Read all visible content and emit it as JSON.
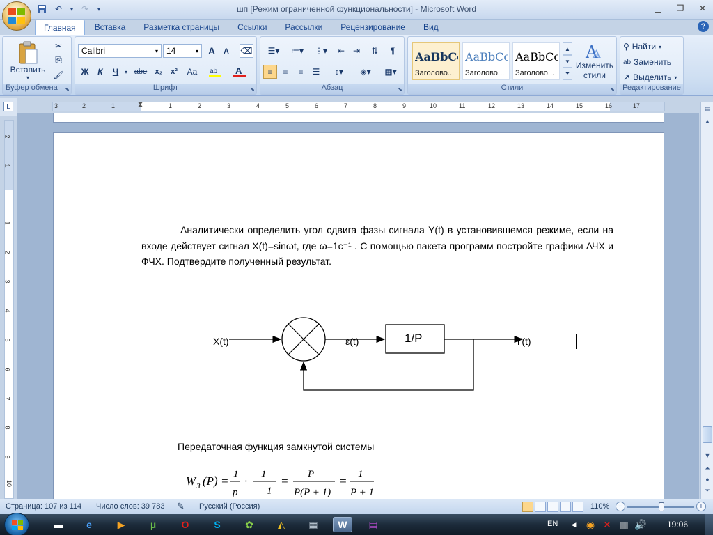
{
  "window": {
    "title": "шп [Режим ограниченной функциональности] - Microsoft Word"
  },
  "ribbon_tabs": [
    "Главная",
    "Вставка",
    "Разметка страницы",
    "Ссылки",
    "Рассылки",
    "Рецензирование",
    "Вид"
  ],
  "active_tab": "Главная",
  "clipboard": {
    "paste_label": "Вставить",
    "group_label": "Буфер обмена"
  },
  "font": {
    "name": "Calibri",
    "size": "14",
    "grow": "A",
    "shrink": "A",
    "bold": "Ж",
    "italic": "К",
    "underline": "Ч",
    "strike": "abe",
    "subscript": "x₂",
    "superscript": "x²",
    "change_case": "Aa",
    "group_label": "Шрифт"
  },
  "paragraph": {
    "group_label": "Абзац"
  },
  "styles": {
    "items": [
      {
        "sample": "AaBbCc",
        "name": "Заголово..."
      },
      {
        "sample": "AaBbCc",
        "name": "Заголово..."
      },
      {
        "sample": "AaBbCcI",
        "name": "Заголово..."
      }
    ],
    "change_line1": "Изменить",
    "change_line2": "стили",
    "group_label": "Стили"
  },
  "editing": {
    "find": "Найти",
    "replace": "Заменить",
    "select": "Выделить",
    "group_label": "Редактирование"
  },
  "ruler": {
    "h_numbers": [
      "3",
      "2",
      "1",
      "1",
      "2",
      "3",
      "4",
      "5",
      "6",
      "7",
      "8",
      "9",
      "10",
      "11",
      "12",
      "13",
      "14",
      "15",
      "16",
      "17"
    ],
    "v_numbers": [
      "2",
      "1",
      "1",
      "2",
      "3",
      "4",
      "5",
      "6",
      "7",
      "8",
      "9",
      "10"
    ]
  },
  "document": {
    "paragraph": "Аналитически определить угол сдвига фазы сигнала Y(t) в установившемся режиме, если на входе действует сигнал X(t)=sinωt, где ω=1c⁻¹ . С помощью пакета программ постройте графики АЧХ и ФЧХ. Подтвердите полученный результат.",
    "diagram": {
      "input": "X(t)",
      "error": "ε(t)",
      "block": "1/P",
      "output": "Y(t)"
    },
    "caption": "Передаточная функция замкнутой системы",
    "formula": {
      "lhs": "W",
      "lhs_sub": "З",
      "lhs_arg": "(P) =",
      "frac1_num": "1",
      "frac1_den": "p",
      "dot": "·",
      "frac2_num": "1",
      "frac2_den": "1",
      "eq1": "=",
      "frac3_num": "P",
      "frac3_den": "P(P + 1)",
      "eq2": "=",
      "frac4_num": "1",
      "frac4_den": "P + 1"
    }
  },
  "status": {
    "page": "Страница: 107 из 114",
    "words": "Число слов: 39 783",
    "language": "Русский (Россия)",
    "zoom": "110%"
  },
  "taskbar": {
    "lang": "EN",
    "time": "19:06"
  }
}
